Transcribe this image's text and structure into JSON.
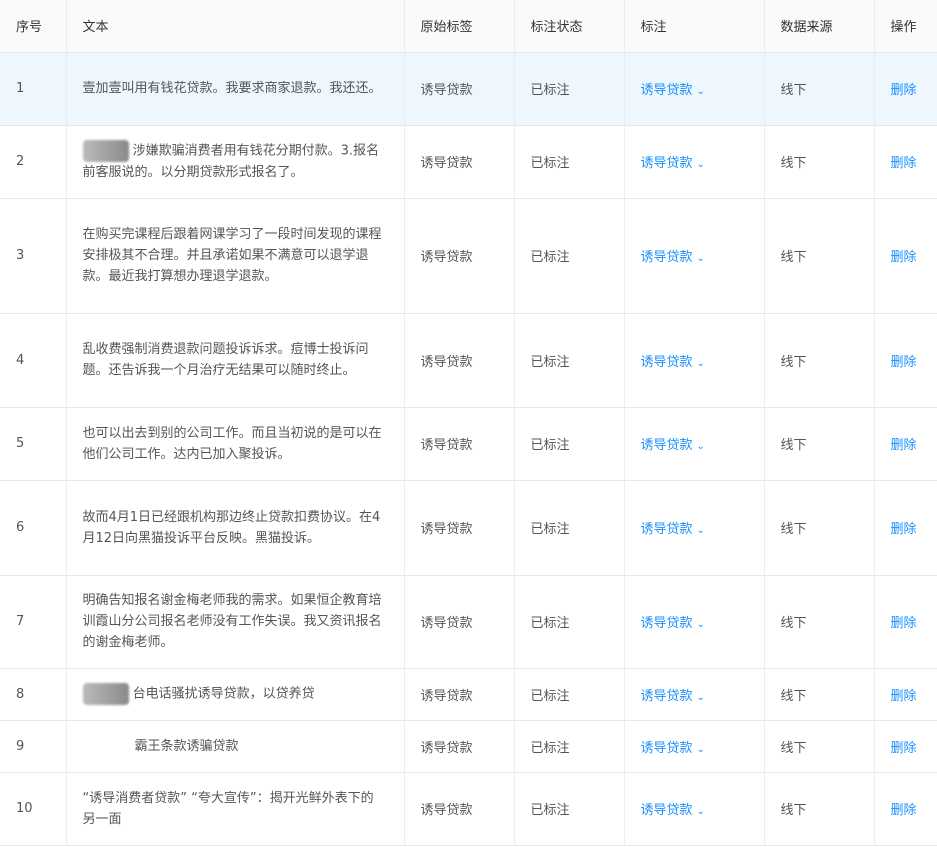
{
  "headers": [
    "序号",
    "文本",
    "原始标签",
    "标注状态",
    "标注",
    "数据来源",
    "操作"
  ],
  "rows": [
    {
      "no": "1",
      "pre": "",
      "text": "壹加壹叫用有钱花贷款。我要求商家退款。我还还。",
      "orig": "诱导贷款",
      "status": "已标注",
      "label": "诱导贷款",
      "source": "线下",
      "action": "删除",
      "h": 73
    },
    {
      "no": "2",
      "pre": "blur",
      "text": "涉嫌欺骗消费者用有钱花分期付款。3.报名前客服说的。以分期贷款形式报名了。",
      "orig": "诱导贷款",
      "status": "已标注",
      "label": "诱导贷款",
      "source": "线下",
      "action": "删除",
      "h": 73
    },
    {
      "no": "3",
      "pre": "",
      "text": "在购买完课程后跟着网课学习了一段时间发现的课程安排极其不合理。并且承诺如果不满意可以退学退款。最近我打算想办理退学退款。",
      "orig": "诱导贷款",
      "status": "已标注",
      "label": "诱导贷款",
      "source": "线下",
      "action": "删除",
      "h": 115
    },
    {
      "no": "4",
      "pre": "",
      "text": "乱收费强制消费退款问题投诉诉求。痘博士投诉问题。还告诉我一个月治疗无结果可以随时终止。",
      "orig": "诱导贷款",
      "status": "已标注",
      "label": "诱导贷款",
      "source": "线下",
      "action": "删除",
      "h": 94
    },
    {
      "no": "5",
      "pre": "",
      "text": "也可以出去到别的公司工作。而且当初说的是可以在他们公司工作。达内已加入聚投诉。",
      "orig": "诱导贷款",
      "status": "已标注",
      "label": "诱导贷款",
      "source": "线下",
      "action": "删除",
      "h": 73
    },
    {
      "no": "6",
      "pre": "",
      "text": "故而4月1日已经跟机构那边终止贷款扣费协议。在4月12日向黑猫投诉平台反映。黑猫投诉。",
      "orig": "诱导贷款",
      "status": "已标注",
      "label": "诱导贷款",
      "source": "线下",
      "action": "删除",
      "h": 95
    },
    {
      "no": "7",
      "pre": "",
      "text": "明确告知报名谢金梅老师我的需求。如果恒企教育培训霞山分公司报名老师没有工作失误。我又资讯报名的谢金梅老师。",
      "orig": "诱导贷款",
      "status": "已标注",
      "label": "诱导贷款",
      "source": "线下",
      "action": "删除",
      "h": 93
    },
    {
      "no": "8",
      "pre": "blur",
      "text": "台电话骚扰诱导贷款，以贷养贷",
      "orig": "诱导贷款",
      "status": "已标注",
      "label": "诱导贷款",
      "source": "线下",
      "action": "删除",
      "h": 52
    },
    {
      "no": "9",
      "pre": "space",
      "text": "霸王条款诱骗贷款",
      "orig": "诱导贷款",
      "status": "已标注",
      "label": "诱导贷款",
      "source": "线下",
      "action": "删除",
      "h": 52
    },
    {
      "no": "10",
      "pre": "",
      "text": "“诱导消费者贷款” “夸大宣传”：揭开光鲜外表下的另一面",
      "orig": "诱导贷款",
      "status": "已标注",
      "label": "诱导贷款",
      "source": "线下",
      "action": "删除",
      "h": 73
    }
  ]
}
